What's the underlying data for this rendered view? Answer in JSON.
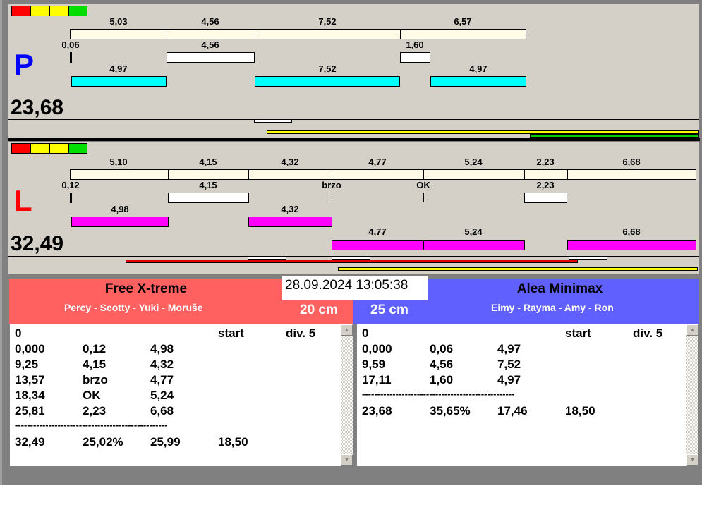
{
  "top_panel": {
    "letter": "P",
    "total": "23,68",
    "row1": [
      "5,03",
      "4,56",
      "7,52",
      "6,57"
    ],
    "row2": [
      "0,06",
      "4,56",
      "1,60"
    ],
    "row3": [
      "4,97",
      "7,52",
      "4,97"
    ]
  },
  "bottom_panel": {
    "letter": "L",
    "total": "32,49",
    "row1": [
      "5,10",
      "4,15",
      "4,32",
      "4,77",
      "5,24",
      "2,23",
      "6,68"
    ],
    "row2": [
      "0,12",
      "4,15",
      "brzo",
      "OK",
      "2,23"
    ],
    "row3": [
      "4,98",
      "4,32"
    ],
    "row4": [
      "4,77",
      "5,24",
      "6,68"
    ]
  },
  "colors": {
    "left_team": "#ff6060",
    "right_team": "#6060ff",
    "cyan": "#00ffff",
    "magenta": "#ff00ff"
  },
  "datetime": "28.09.2024 13:05:38",
  "left_team": {
    "name": "Free X-treme",
    "crew": "Percy - Scotty - Yuki - Moruše",
    "height": "20 cm",
    "rows": [
      [
        "0",
        "",
        "",
        "start",
        "div. 5"
      ],
      [
        "0,000",
        "0,12",
        "4,98",
        "",
        ""
      ],
      [
        "9,25",
        "4,15",
        "4,32",
        "",
        ""
      ],
      [
        "13,57",
        "brzo",
        "4,77",
        "",
        ""
      ],
      [
        "18,34",
        "OK",
        "5,24",
        "",
        ""
      ],
      [
        "25,81",
        "2,23",
        "6,68",
        "",
        ""
      ],
      [
        "--------------------------------------------------",
        "",
        "",
        "",
        ""
      ],
      [
        "32,49",
        "25,02%",
        "25,99",
        "18,50",
        ""
      ]
    ]
  },
  "right_team": {
    "name": "Alea Minimax",
    "crew": "Eimy - Rayma - Amy - Ron",
    "height": "25 cm",
    "rows": [
      [
        "0",
        "",
        "",
        "start",
        "div. 5"
      ],
      [
        "0,000",
        "0,06",
        "4,97",
        "",
        ""
      ],
      [
        "9,59",
        "4,56",
        "7,52",
        "",
        ""
      ],
      [
        "17,11",
        "1,60",
        "4,97",
        "",
        ""
      ],
      [
        "--------------------------------------------------",
        "",
        "",
        "",
        ""
      ],
      [
        "23,68",
        "35,65%",
        "17,46",
        "18,50",
        ""
      ]
    ]
  }
}
